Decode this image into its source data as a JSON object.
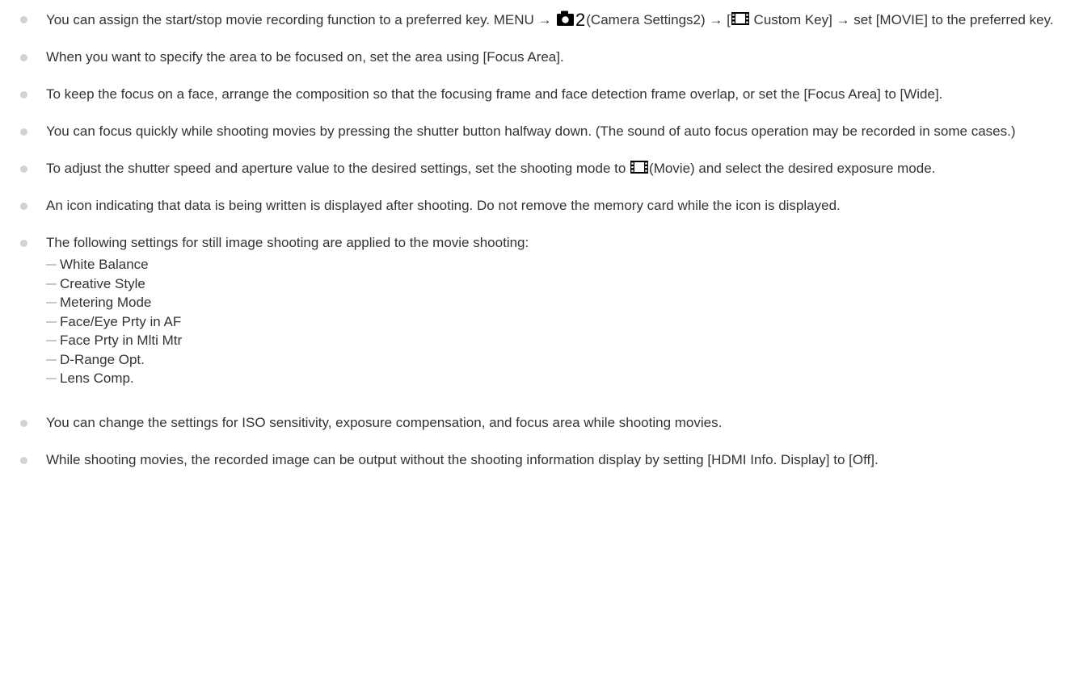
{
  "items": [
    {
      "parts": [
        "You can assign the start/stop movie recording function to a preferred key. MENU → ",
        "(Camera Settings2) → [",
        " Custom Key] → set [MOVIE] to the preferred key."
      ],
      "icons": [
        "camera-settings2-icon",
        "movie-icon"
      ]
    },
    {
      "text": "When you want to specify the area to be focused on, set the area using [Focus Area]."
    },
    {
      "text": "To keep the focus on a face, arrange the composition so that the focusing frame and face detection frame overlap, or set the [Focus Area] to [Wide]."
    },
    {
      "text": "You can focus quickly while shooting movies by pressing the shutter button halfway down. (The sound of auto focus operation may be recorded in some cases.)"
    },
    {
      "parts": [
        "To adjust the shutter speed and aperture value to the desired settings, set the shooting mode to ",
        "(Movie) and select the desired exposure mode."
      ],
      "icons": [
        "movie-icon"
      ]
    },
    {
      "text": "An icon indicating that data is being written is displayed after shooting. Do not remove the memory card while the icon is displayed."
    },
    {
      "text": "The following settings for still image shooting are applied to the movie shooting:",
      "subitems": [
        "White Balance",
        "Creative Style",
        "Metering Mode",
        "Face/Eye Prty in AF",
        "Face Prty in Mlti Mtr",
        "D-Range Opt.",
        "Lens Comp."
      ]
    },
    {
      "text": "You can change the settings for ISO sensitivity, exposure compensation, and focus area while shooting movies."
    },
    {
      "text": "While shooting movies, the recorded image can be output without the shooting information display by setting [HDMI Info. Display] to [Off]."
    }
  ],
  "icon_colors": {
    "bullet": "#d2d2d2",
    "dash": "#c8c8c8",
    "camera": "#000000",
    "text": "#333333"
  }
}
